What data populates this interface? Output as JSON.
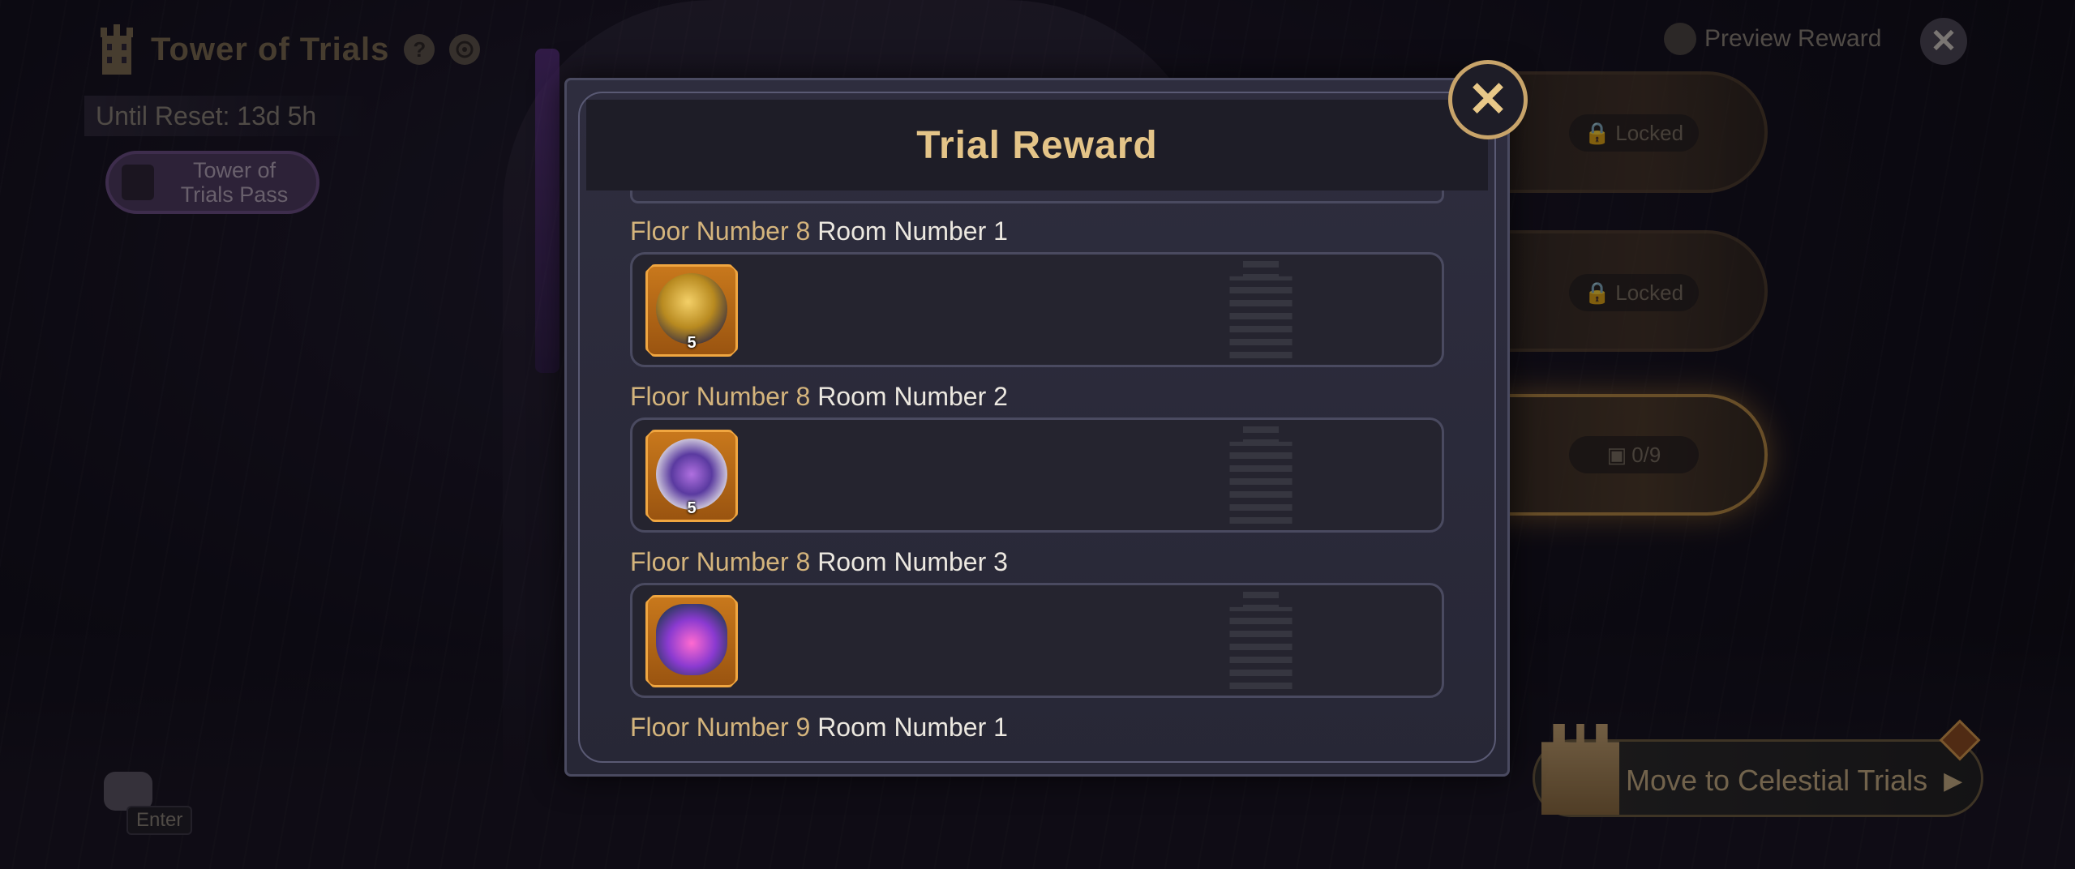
{
  "hud": {
    "title": "Tower of Trials",
    "help_icon": "?",
    "reset_text": "Until Reset: 13d 5h",
    "pass_label": "Tower of Trials Pass",
    "preview_reward": "Preview Reward",
    "close_glyph": "✕"
  },
  "floors": [
    {
      "tag": "Locked"
    },
    {
      "tag": "Locked"
    },
    {
      "tag": "0/9"
    }
  ],
  "celestial": {
    "label": "Move to Celestial Trials",
    "arrow": "▶",
    "badge": "!"
  },
  "chat": {
    "enter_label": "Enter"
  },
  "modal": {
    "title": "Trial Reward",
    "close_glyph": "✕",
    "rows": [
      {
        "floor": "Floor Number 8",
        "room": "Room Number 1",
        "item": "gold-gear-emblem",
        "qty": "5"
      },
      {
        "floor": "Floor Number 8",
        "room": "Room Number 2",
        "item": "purple-orb-emblem",
        "qty": "5"
      },
      {
        "floor": "Floor Number 8",
        "room": "Room Number 3",
        "item": "potion-flask",
        "qty": ""
      },
      {
        "floor": "Floor Number 9",
        "room": "Room Number 1"
      }
    ]
  },
  "colors": {
    "gold_text": "#d4b47c",
    "title_gold": "#e4c488",
    "item_frame_orange": "#c8781c",
    "panel_bg": "#2e2d3e"
  }
}
